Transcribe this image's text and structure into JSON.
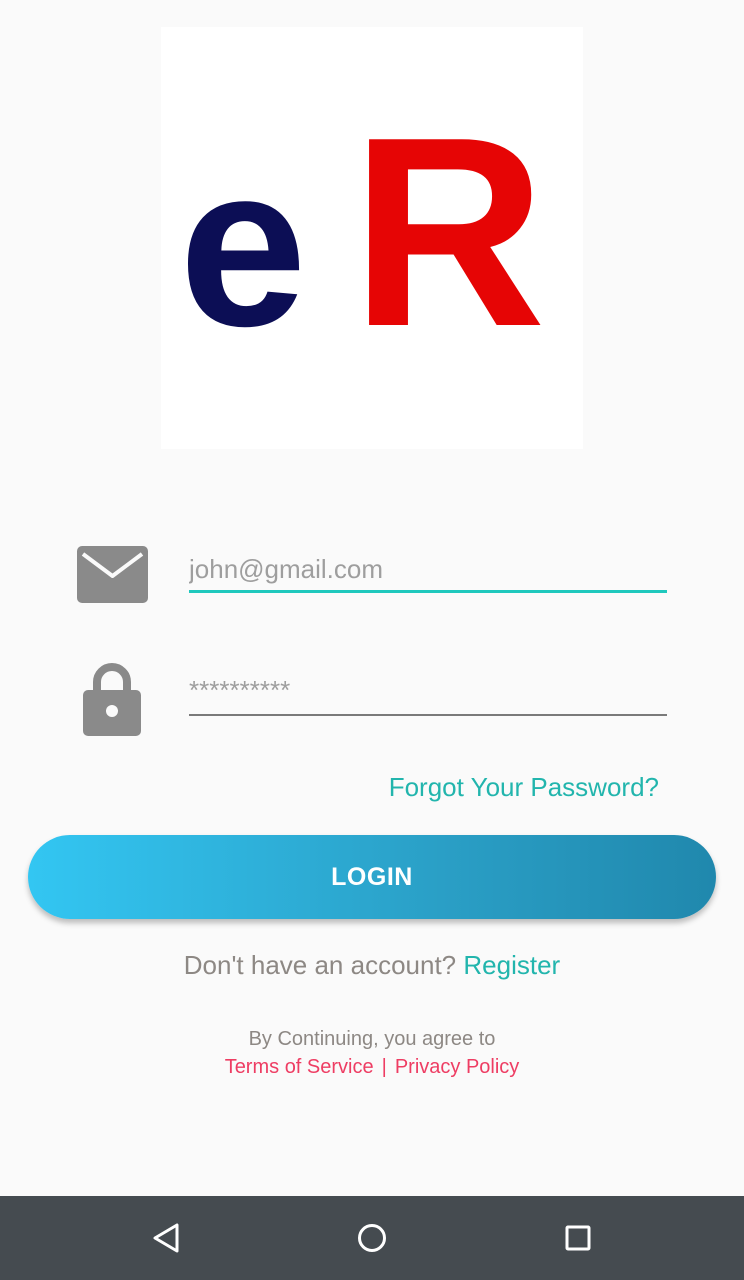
{
  "logo": {
    "letter_e": "e",
    "letter_r": "R",
    "color_e": "#0c0e55",
    "color_r": "#e60505"
  },
  "email": {
    "placeholder": "john@gmail.com",
    "icon": "envelope-icon"
  },
  "password": {
    "placeholder": "**********",
    "icon": "lock-icon"
  },
  "forgot_password": "Forgot Your Password?",
  "login_button": "LOGIN",
  "register": {
    "prompt": "Don't have an account?",
    "link": "Register"
  },
  "terms": {
    "intro": "By Continuing, you agree to",
    "terms_link": "Terms of Service",
    "separator": "|",
    "privacy_link": "Privacy Policy"
  },
  "navbar": {
    "back_icon": "back-triangle-icon",
    "home_icon": "home-circle-icon",
    "recents_icon": "recents-square-icon"
  },
  "colors": {
    "accent": "#22b5ad",
    "link_red": "#ee3d63",
    "button_start": "#33c6f2",
    "button_end": "#2088ad"
  }
}
